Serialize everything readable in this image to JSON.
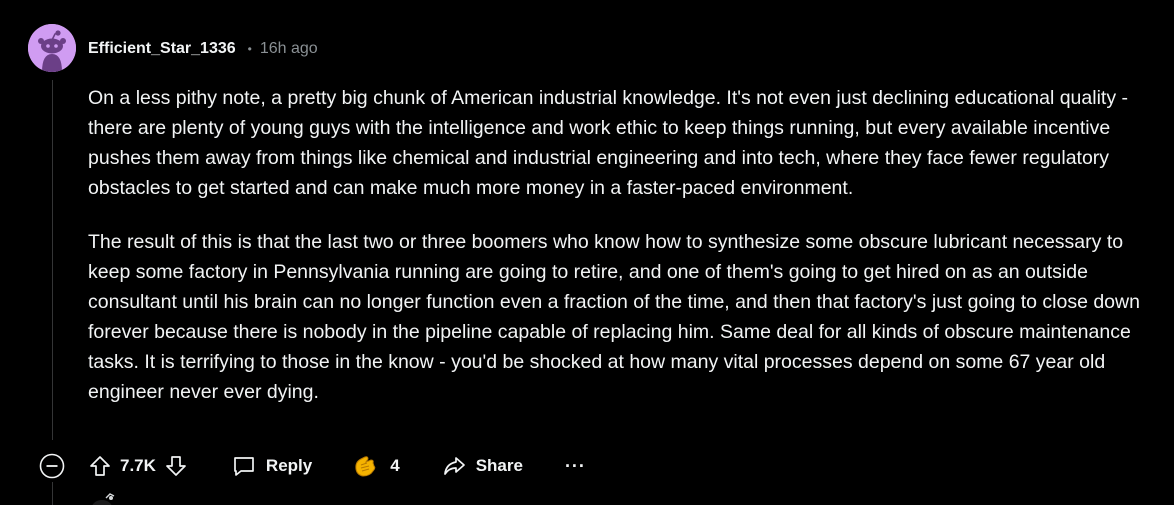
{
  "comment": {
    "username": "Efficient_Star_1336",
    "separator": "•",
    "time": "16h ago",
    "paragraphs": [
      "On a less pithy note, a pretty big chunk of American industrial knowledge. It's not even just declining educational quality - there are plenty of young guys with the intelligence and work ethic to keep things running, but every available incentive pushes them away from things like chemical and industrial engineering and into tech, where they face fewer regulatory obstacles to get started and can make much more money in a faster-paced environment.",
      "The result of this is that the last two or three boomers who know how to synthesize some obscure lubricant necessary to keep some factory in Pennsylvania running are going to retire, and one of them's going to get hired on as an outside consultant until his brain can no longer function even a fraction of the time, and then that factory's just going to close down forever because there is nobody in the pipeline capable of replacing him. Same deal for all kinds of obscure maintenance tasks. It is terrifying to those in the know - you'd be shocked at how many vital processes depend on some 67 year old engineer never ever dying."
    ]
  },
  "actions": {
    "vote_count": "7.7K",
    "reply_label": "Reply",
    "award_count": "4",
    "share_label": "Share",
    "more_label": "···"
  },
  "colors": {
    "background": "#000000",
    "text": "#f2f4f5",
    "muted": "#8a9094",
    "avatar_bg": "#d09cf2",
    "award": "#f5b300"
  },
  "icons": {
    "collapse": "collapse-minus-icon",
    "upvote": "upvote-arrow-icon",
    "downvote": "downvote-arrow-icon",
    "reply": "comment-bubble-icon",
    "award": "award-hands-icon",
    "share": "share-arrow-icon",
    "more": "more-options-icon"
  }
}
